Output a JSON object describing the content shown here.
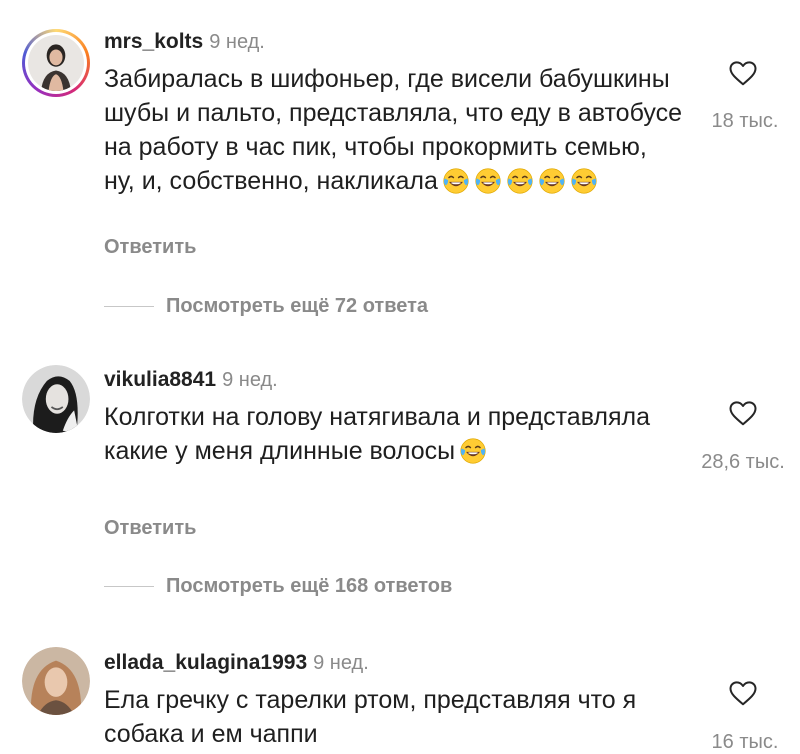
{
  "comments": [
    {
      "username": "mrs_kolts",
      "time": "9 нед.",
      "text": "Забиралась в шифоньер, где висели бабушкины шубы и пальто, представляла, что еду в автобусе на работу в час пик, чтобы прокормить семью,  ну, и, собственно, накликала",
      "emoji_icon": "face-with-tears-of-joy-icon",
      "emoji_count": 5,
      "reply": "Ответить",
      "likes": "18 тыс.",
      "more_replies": "Посмотреть ещё 72 ответа"
    },
    {
      "username": "vikulia8841",
      "time": "9 нед.",
      "text": "Колготки на голову натягивала и представляла какие у меня длинные волосы",
      "emoji_icon": "face-with-tears-of-joy-icon",
      "emoji_count": 1,
      "reply": "Ответить",
      "likes": "28,6 тыс.",
      "more_replies": "Посмотреть ещё 168 ответов"
    },
    {
      "username": "ellada_kulagina1993",
      "time": "9 нед.",
      "text": "Ела гречку с тарелки ртом, представляя что я собака и ем чаппи",
      "likes": "16 тыс."
    }
  ],
  "colors": {
    "text": "#1f1f1f",
    "muted": "#8a8a8a"
  }
}
